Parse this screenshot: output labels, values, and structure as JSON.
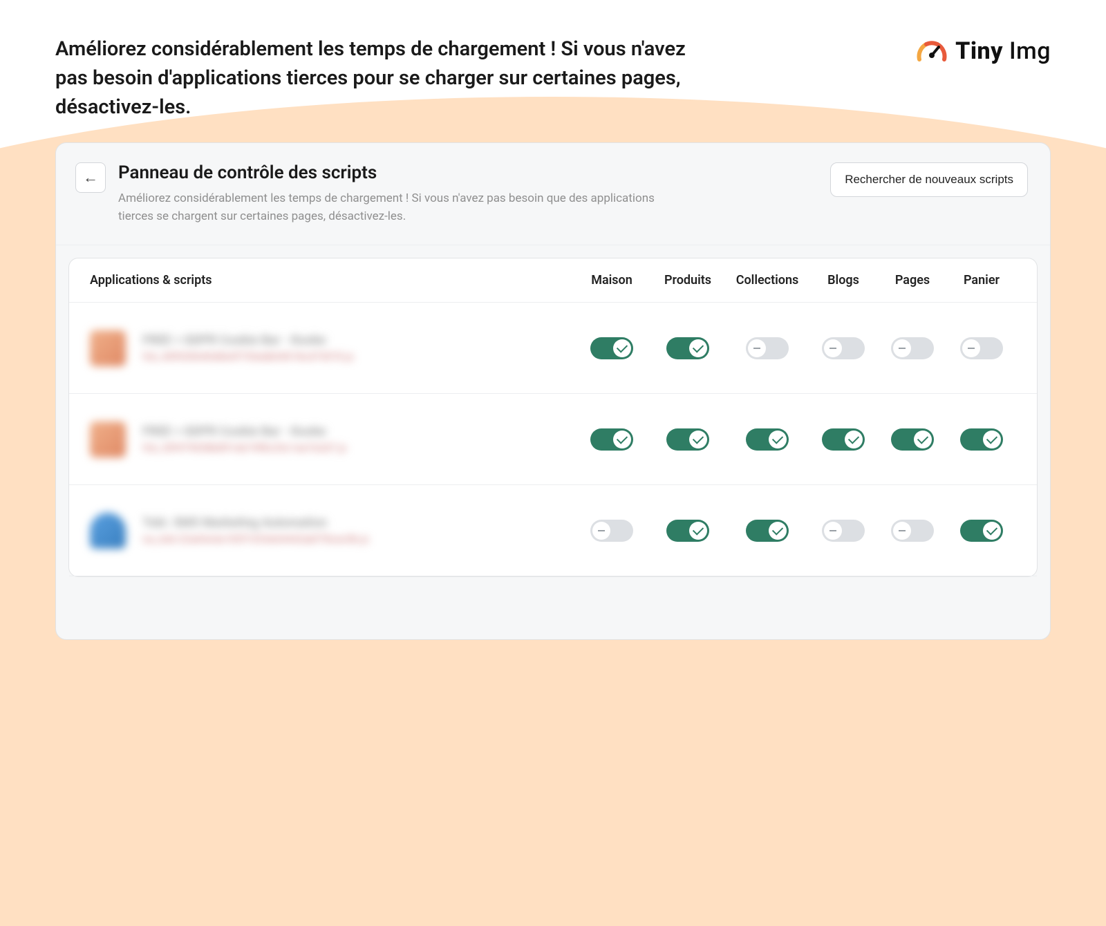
{
  "tagline": "Améliorez considérablement les temps de chargement ! Si vous n'avez pas besoin d'applications tierces pour se charger sur certaines pages, désactivez-les.",
  "logo": {
    "brand_a": "Tiny",
    "brand_b": "Img"
  },
  "panel": {
    "title": "Panneau de contrôle des scripts",
    "subtitle": "Améliorez considérablement les temps de chargement ! Si vous n'avez pas besoin que des applications tierces se chargent sur certaines pages, désactivez-les.",
    "search_button": "Rechercher de nouveaux scripts"
  },
  "columns": {
    "apps": "Applications & scripts",
    "c0": "Maison",
    "c1": "Produits",
    "c2": "Collections",
    "c3": "Blogs",
    "c4": "Pages",
    "c5": "Panier"
  },
  "rows": [
    {
      "name": "FREE > GDPR Cookie Bar - Kooke",
      "file": "fcb_40f030640d6b4f735edb04018cd73070.js",
      "icon": "ic1",
      "toggles": [
        true,
        true,
        false,
        false,
        false,
        false
      ]
    },
    {
      "name": "FREE > GDPR Cookie Bar - Kooke",
      "file": "fcb_30f479658b891eb74f8c33c1ee7e2d7.js",
      "icon": "ic2",
      "toggles": [
        true,
        true,
        true,
        true,
        true,
        true
      ]
    },
    {
      "name": "Tobi. SMS Marketing Automation",
      "file": "na_tobi-22a64c6e183f1033e64442abf78cec0b.js",
      "icon": "ic3",
      "toggles": [
        false,
        true,
        true,
        false,
        false,
        true
      ]
    }
  ]
}
